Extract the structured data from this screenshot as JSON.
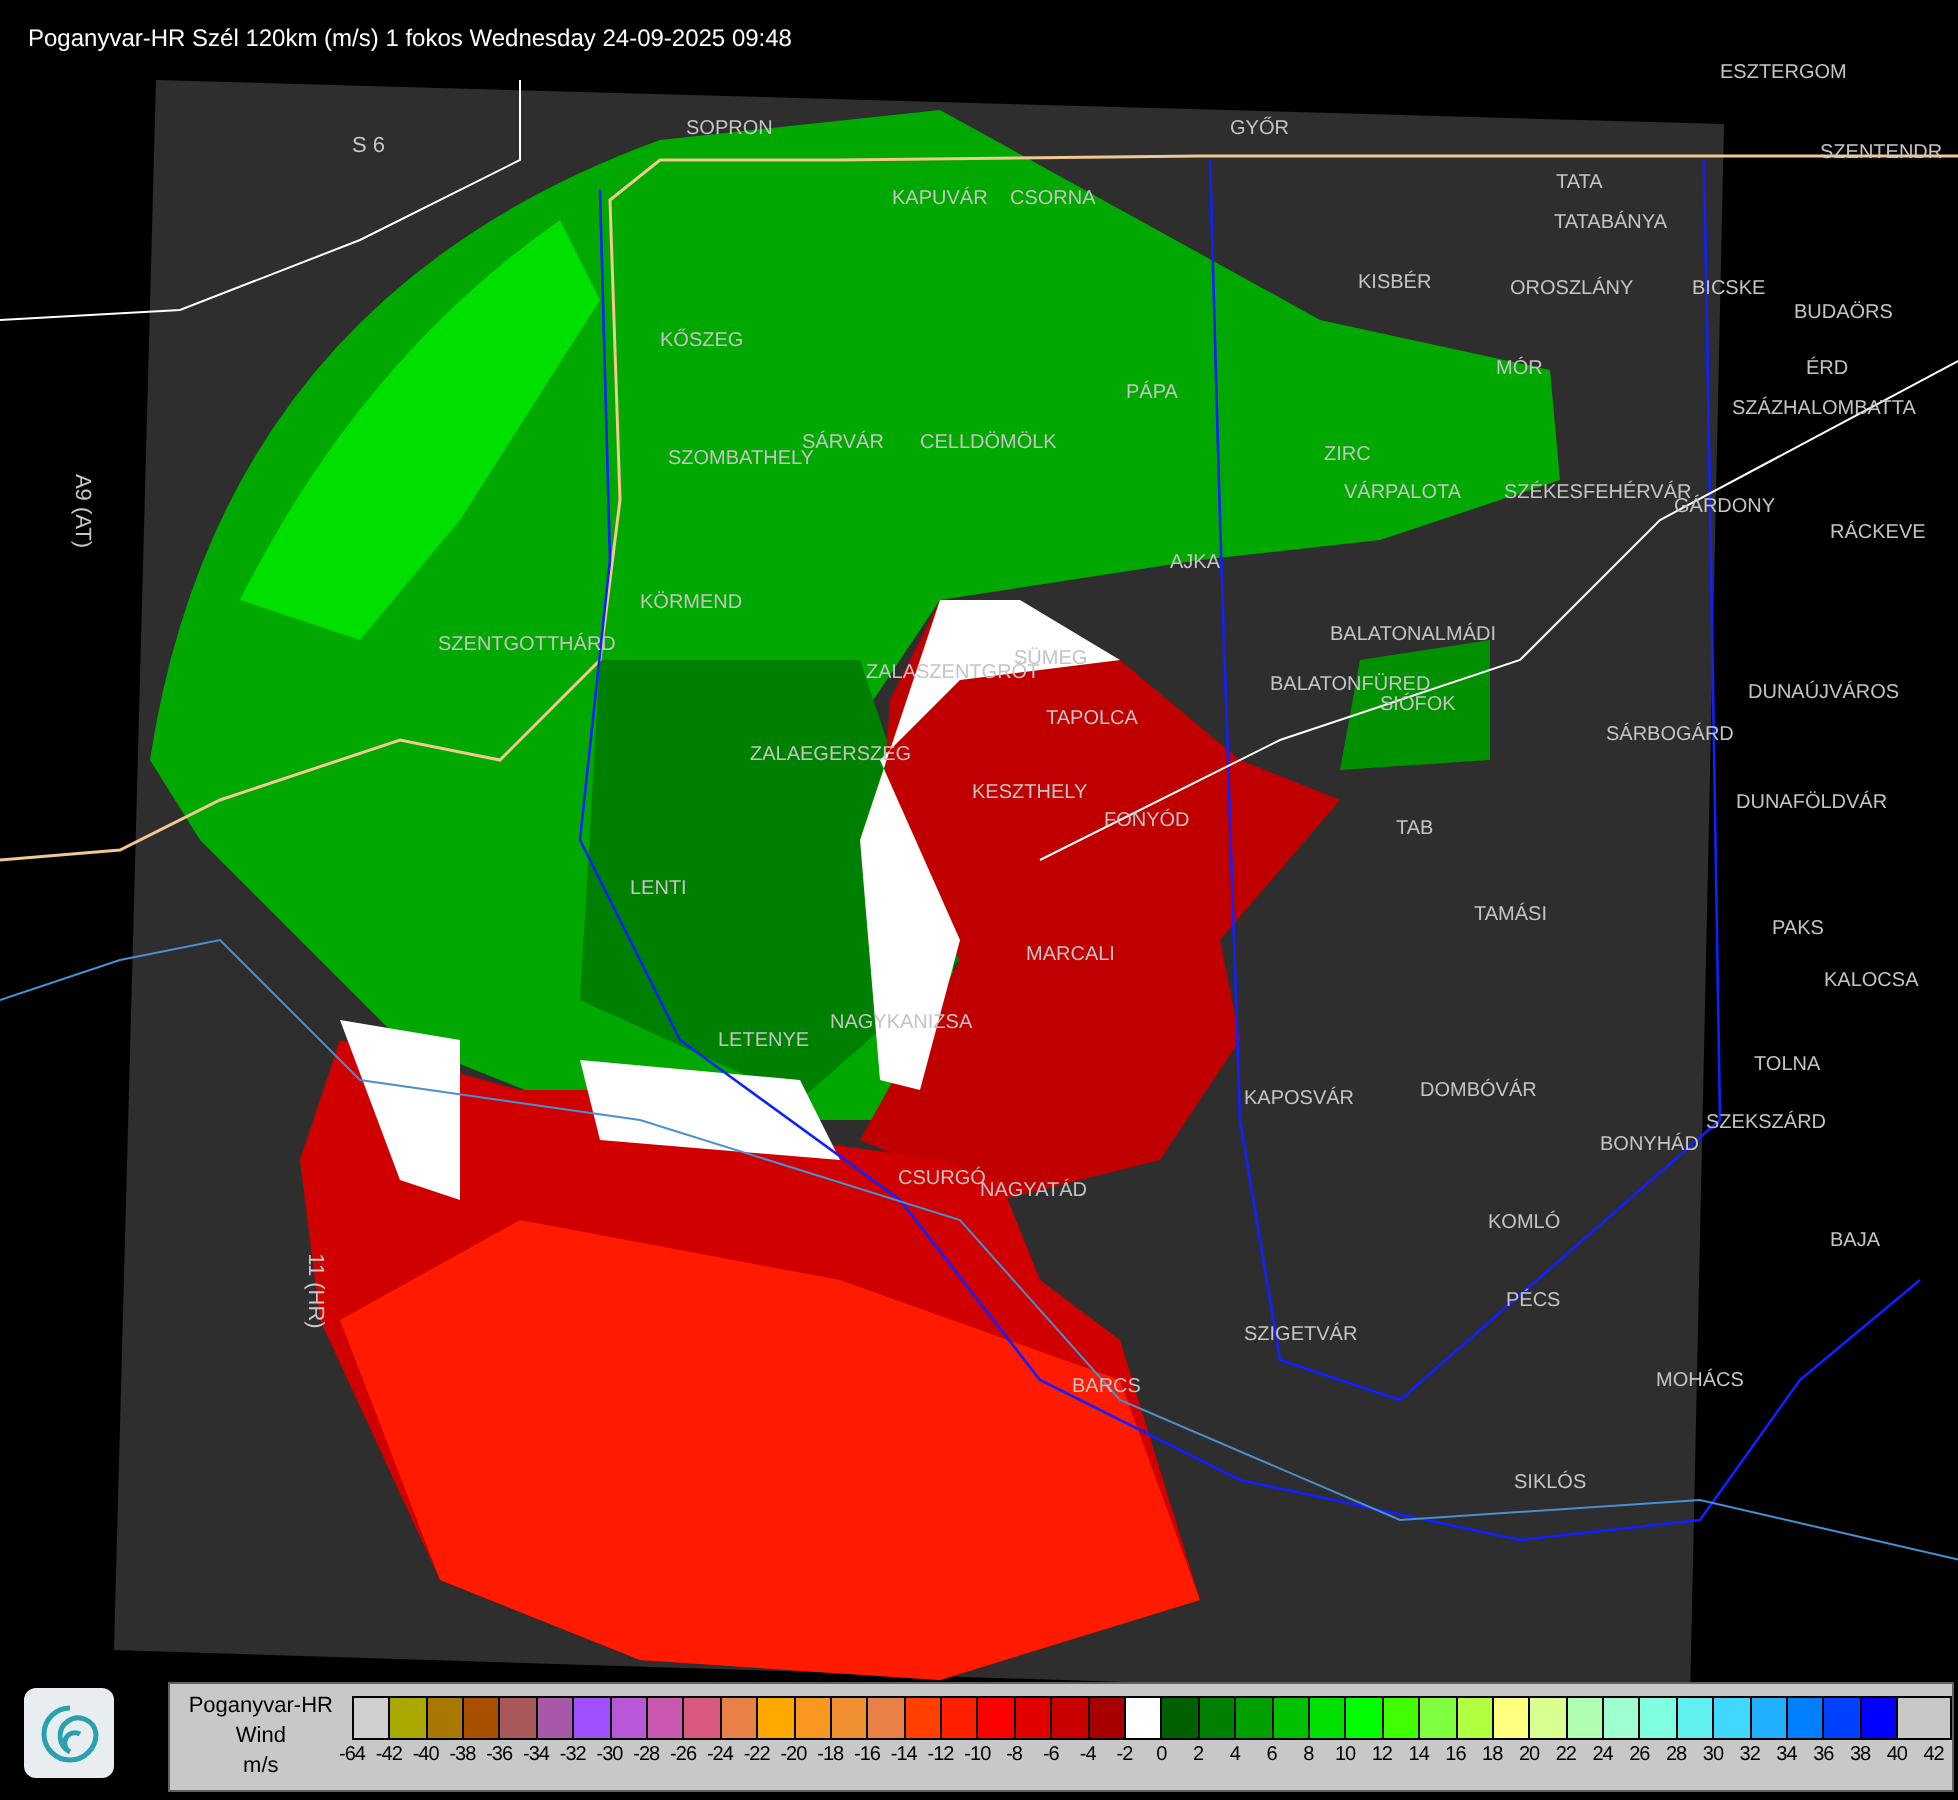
{
  "title": "Poganyvar-HR Szél 120km (m/s) 1 fokos Wednesday 24-09-2025 09:48",
  "map": {
    "road_labels": [
      "S 6",
      "A9 (AT)",
      "11 (HR)"
    ],
    "places": [
      "SOPRON",
      "KAPUVÁR",
      "CSORNA",
      "GYŐR",
      "ESZTERGOM",
      "SZENTENDR",
      "TATA",
      "TATABÁNYA",
      "KISBÉR",
      "OROSZLÁNY",
      "BICSKE",
      "BUDAÖRS",
      "ÉRD",
      "SZÁZHALOMBATTA",
      "MÓR",
      "PÁPA",
      "KŐSZEG",
      "SÁRVÁR",
      "CELLDÖMÖLK",
      "SZOMBATHELY",
      "ZIRC",
      "VÁRPALOTA",
      "SZÉKESFEHÉRVÁR",
      "GÁRDONY",
      "RÁCKEVE",
      "AJKA",
      "KÖRMEND",
      "SZENTGOTTHÁRD",
      "SÜMEG",
      "ZALASZENTGRÓT",
      "TAPOLCA",
      "BALATONALMÁDI",
      "BALATONFÜRED",
      "SIÓFOK",
      "SÁRBOGÁRD",
      "DUNAÚJVÁROS",
      "ZALAEGERSZEG",
      "KESZTHELY",
      "FONYÓD",
      "DUNAFÖLDVÁR",
      "TAB",
      "LENTI",
      "TAMÁSI",
      "PAKS",
      "MARCALI",
      "KALOCSA",
      "NAGYKANIZSA",
      "LETENYE",
      "TOLNA",
      "KAPOSVÁR",
      "DOMBÓVÁR",
      "SZEKSZÁRD",
      "BONYHÁD",
      "CSURGÓ",
      "NAGYATÁD",
      "KOMLÓ",
      "BAJA",
      "PÉCS",
      "SZIGETVÁR",
      "MOHÁCS",
      "BARCS",
      "SIKLÓS"
    ]
  },
  "legend": {
    "station": "Poganyvar-HR",
    "quantity": "Wind",
    "unit": "m/s",
    "swatches": [
      {
        "color": "#d0d0d0"
      },
      {
        "color": "#a8a800"
      },
      {
        "color": "#a87800"
      },
      {
        "color": "#a85000"
      },
      {
        "color": "#a85858"
      },
      {
        "color": "#a858a8"
      },
      {
        "color": "#a050ff"
      },
      {
        "color": "#b858d8"
      },
      {
        "color": "#c858b0"
      },
      {
        "color": "#d85880"
      },
      {
        "color": "#e88048"
      },
      {
        "color": "#ffa800"
      },
      {
        "color": "#f89820"
      },
      {
        "color": "#f09030"
      },
      {
        "color": "#e88048"
      },
      {
        "color": "#ff4000"
      },
      {
        "color": "#ff2000"
      },
      {
        "color": "#ff0000"
      },
      {
        "color": "#e00000"
      },
      {
        "color": "#c80000"
      },
      {
        "color": "#a80000"
      },
      {
        "color": "#ffffff"
      },
      {
        "color": "#006000"
      },
      {
        "color": "#008000"
      },
      {
        "color": "#00a000"
      },
      {
        "color": "#00c000"
      },
      {
        "color": "#00e000"
      },
      {
        "color": "#00ff00"
      },
      {
        "color": "#40ff00"
      },
      {
        "color": "#80ff40"
      },
      {
        "color": "#b0ff40"
      },
      {
        "color": "#ffff80"
      },
      {
        "color": "#d8ff90"
      },
      {
        "color": "#b0ffb0"
      },
      {
        "color": "#a0ffd0"
      },
      {
        "color": "#80ffe0"
      },
      {
        "color": "#60f0f0"
      },
      {
        "color": "#40d8ff"
      },
      {
        "color": "#20b0ff"
      },
      {
        "color": "#0080ff"
      },
      {
        "color": "#0040ff"
      },
      {
        "color": "#0000ff"
      }
    ],
    "ticks": [
      "-64",
      "-42",
      "-40",
      "-38",
      "-36",
      "-34",
      "-32",
      "-30",
      "-28",
      "-26",
      "-24",
      "-22",
      "-20",
      "-18",
      "-16",
      "-14",
      "-12",
      "-10",
      "-8",
      "-6",
      "-4",
      "-2",
      "0",
      "2",
      "4",
      "6",
      "8",
      "10",
      "12",
      "14",
      "16",
      "18",
      "20",
      "22",
      "24",
      "26",
      "28",
      "30",
      "32",
      "34",
      "36",
      "38",
      "40",
      "42"
    ]
  }
}
